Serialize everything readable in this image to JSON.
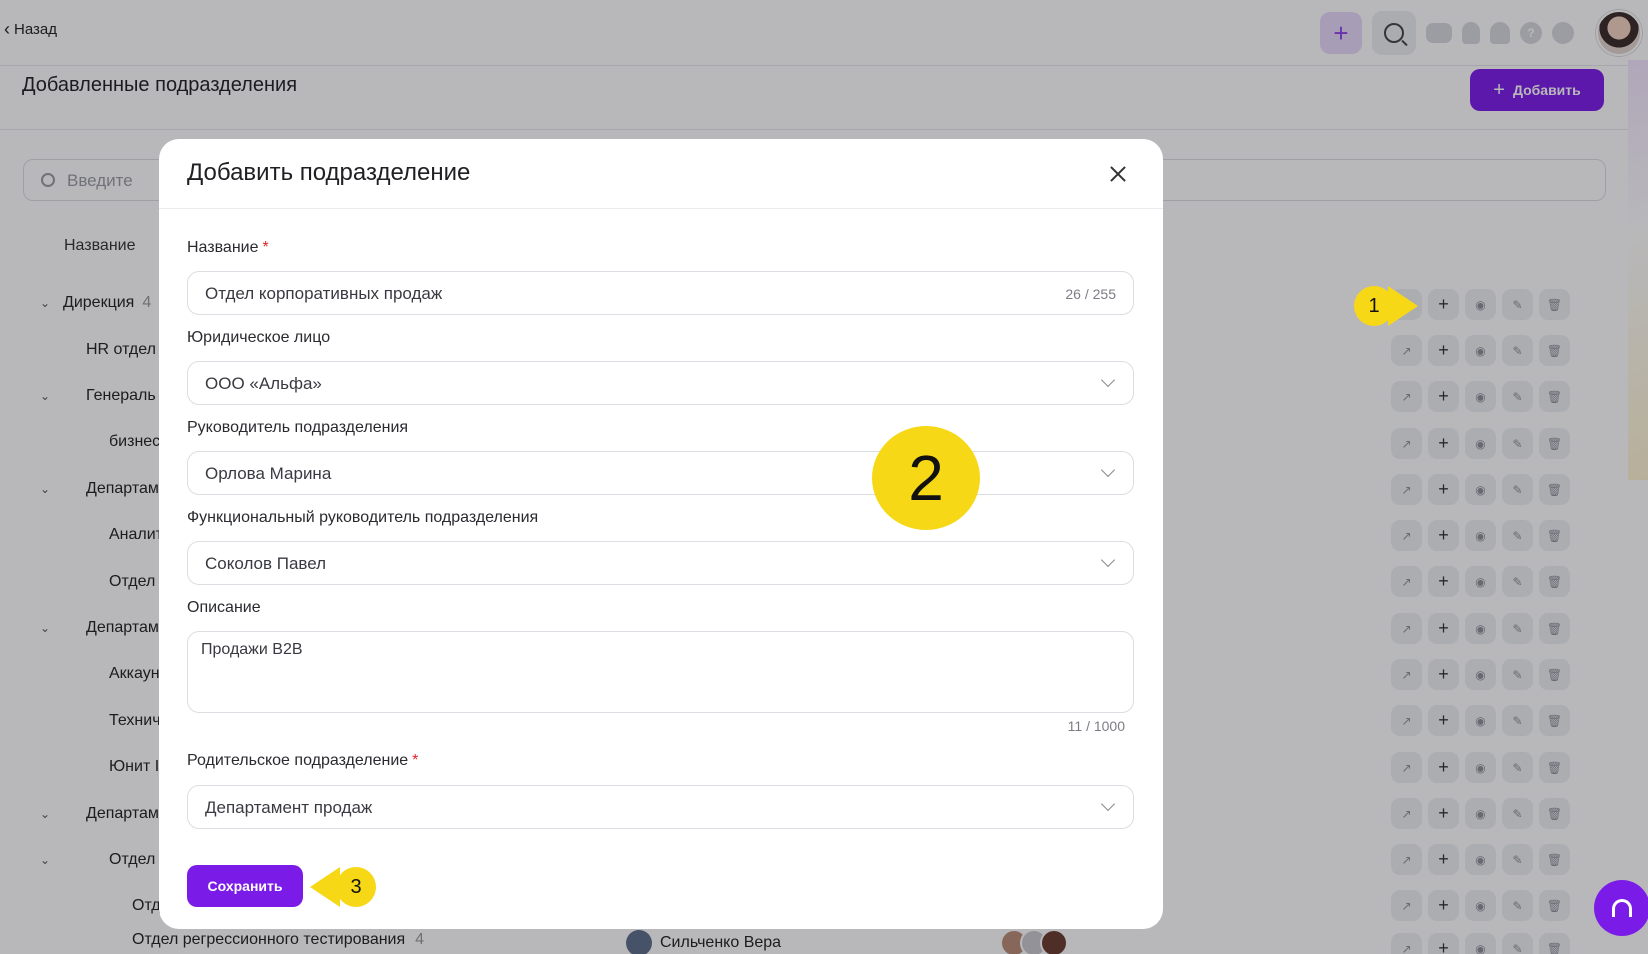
{
  "topbar": {
    "back_label": "Назад",
    "icons": [
      "plus-icon",
      "search-icon",
      "chat-icon",
      "lightbulb-icon",
      "bell-icon",
      "help-icon",
      "settings-icon"
    ],
    "help_glyph": "?"
  },
  "page": {
    "title": "Добавленные подразделения",
    "add_button_label": "Добавить",
    "search_placeholder": "Введите",
    "column_header": "Название"
  },
  "tree": {
    "rows": [
      {
        "label": "Дирекция",
        "count": "4"
      },
      {
        "label": "HR отдел"
      },
      {
        "label": "Генераль"
      },
      {
        "label": "бизнес"
      },
      {
        "label": "Департам"
      },
      {
        "label": "Аналит"
      },
      {
        "label": "Отдел"
      },
      {
        "label": "Департам"
      },
      {
        "label": "Аккаун"
      },
      {
        "label": "Технич"
      },
      {
        "label": "Юнит I"
      },
      {
        "label": "Департам"
      },
      {
        "label": "Отдел"
      },
      {
        "label": "Отд"
      }
    ],
    "last_row": {
      "label": "Отдел регрессионного тестирования",
      "count": "4",
      "manager": "Сильченко Вера"
    }
  },
  "modal": {
    "title": "Добавить подразделение",
    "fields": {
      "name": {
        "label": "Название",
        "required_mark": "*",
        "value": "Отдел корпоративных продаж",
        "counter": "26 / 255"
      },
      "legal_entity": {
        "label": "Юридическое лицо",
        "value": "ООО «Альфа»"
      },
      "head": {
        "label": "Руководитель подразделения",
        "value": "Орлова Марина"
      },
      "functional_head": {
        "label": "Функциональный руководитель подразделения",
        "value": "Соколов Павел"
      },
      "description": {
        "label": "Описание",
        "value": "Продажи B2B",
        "counter": "11 / 1000"
      },
      "parent": {
        "label": "Родительское подразделение",
        "required_mark": "*",
        "value": "Департамент продаж"
      }
    },
    "save_label": "Сохранить"
  },
  "markers": {
    "one": "1",
    "two": "2",
    "three": "3"
  },
  "colors": {
    "accent": "#7a1be8",
    "marker": "#f7d816",
    "required": "#e5232b"
  }
}
